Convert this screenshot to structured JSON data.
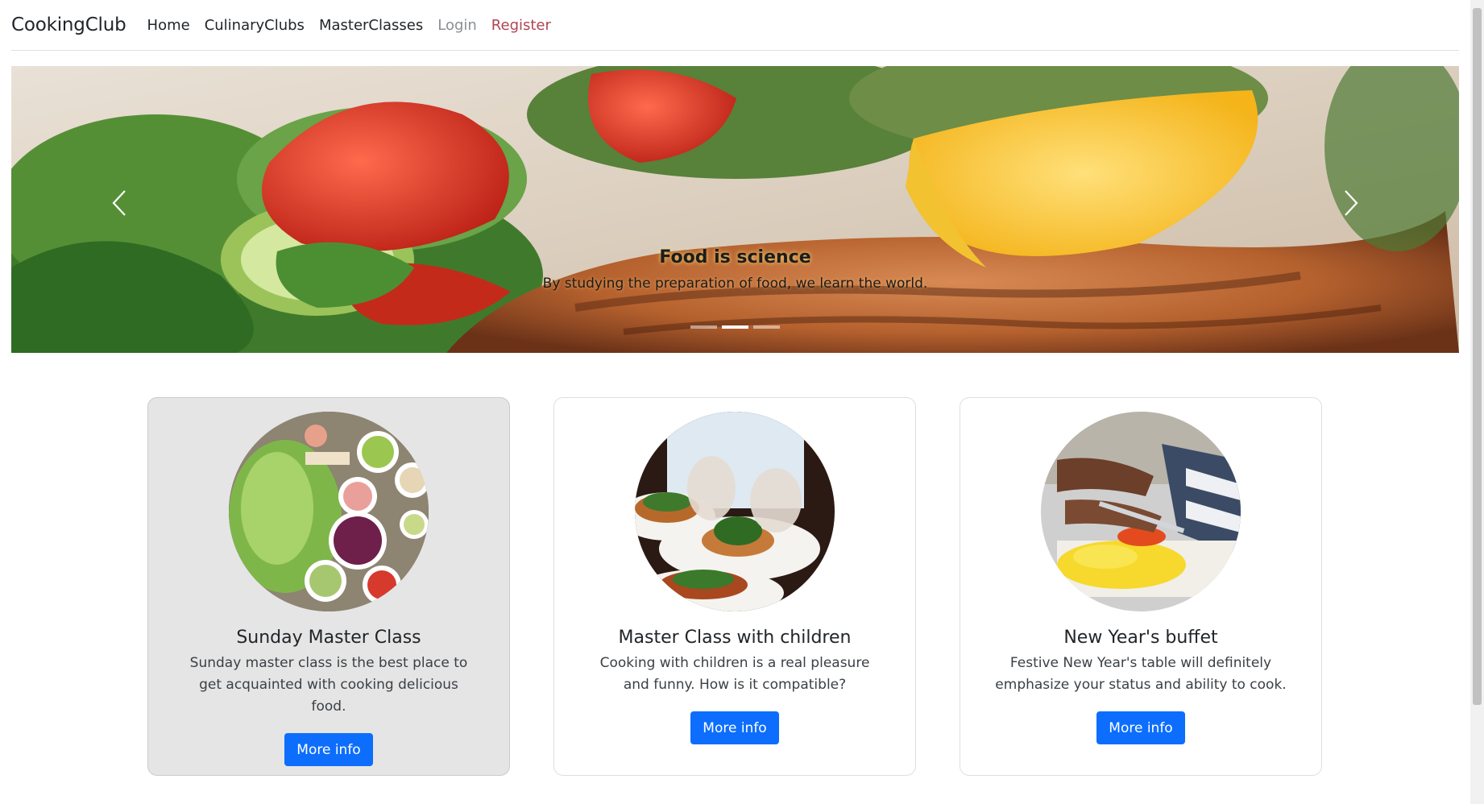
{
  "nav": {
    "brand": "CookingClub",
    "links": [
      "Home",
      "CulinaryClubs",
      "MasterClasses",
      "Login",
      "Register"
    ]
  },
  "carousel": {
    "caption_title": "Food is science",
    "caption_text": "By studying the preparation of food, we learn the world.",
    "slide_count": 3,
    "active_slide": 2
  },
  "cards": [
    {
      "title": "Sunday Master Class",
      "text": "Sunday master class is the best place to get acquainted with cooking delicious food.",
      "button": "More info"
    },
    {
      "title": "Master Class with children",
      "text": "Cooking with children is a real pleasure and funny. How is it compatible?",
      "button": "More info"
    },
    {
      "title": "New Year's buffet",
      "text": "Festive New Year's table will definitely emphasize your status and ability to cook.",
      "button": "More info"
    }
  ],
  "colors": {
    "primary": "#0d6efd",
    "register": "#b04552",
    "login": "#8a8f94"
  }
}
